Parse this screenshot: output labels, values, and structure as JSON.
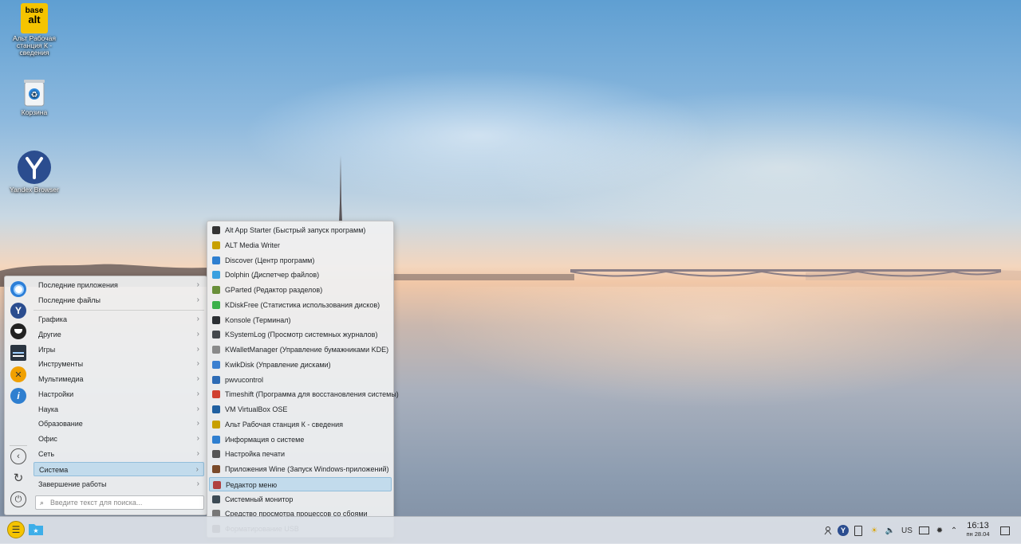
{
  "desktop": {
    "icons": [
      {
        "label": "Альт Рабочая станция К - сведения",
        "logo_text_top": "base",
        "logo_text_bottom": "alt"
      },
      {
        "label": "Корзина"
      },
      {
        "label": "Yandex Browser"
      }
    ]
  },
  "launcher": {
    "favorites": [
      "chromium-icon",
      "yandex-browser-icon",
      "app-icon",
      "system-monitor-icon",
      "tools-icon",
      "info-icon"
    ],
    "categories": [
      {
        "label": "Последние приложения"
      },
      {
        "label": "Последние файлы"
      },
      {
        "label": "Графика"
      },
      {
        "label": "Другие"
      },
      {
        "label": "Игры"
      },
      {
        "label": "Инструменты"
      },
      {
        "label": "Мультимедиа"
      },
      {
        "label": "Настройки"
      },
      {
        "label": "Наука"
      },
      {
        "label": "Образование"
      },
      {
        "label": "Офис"
      },
      {
        "label": "Сеть"
      },
      {
        "label": "Система"
      },
      {
        "label": "Завершение работы"
      }
    ],
    "selected_category": "Система",
    "search_placeholder": "Введите текст для поиска..."
  },
  "submenu": {
    "items": [
      {
        "label": "Alt App Starter (Быстрый запуск программ)",
        "color": "#333333"
      },
      {
        "label": "ALT Media Writer",
        "color": "#c8a000"
      },
      {
        "label": "Discover (Центр программ)",
        "color": "#2f7fd0"
      },
      {
        "label": "Dolphin (Диспетчер файлов)",
        "color": "#3aa0e0"
      },
      {
        "label": "GParted (Редактор разделов)",
        "color": "#6a8f3a"
      },
      {
        "label": "KDiskFree (Статистика использования дисков)",
        "color": "#3bb04a"
      },
      {
        "label": "Konsole (Терминал)",
        "color": "#2b2f33"
      },
      {
        "label": "KSystemLog (Просмотр системных журналов)",
        "color": "#44484c"
      },
      {
        "label": "KWalletManager (Управление бумажниками KDE)",
        "color": "#8a8a8a"
      },
      {
        "label": "KwikDisk (Управление дисками)",
        "color": "#3a7fd0"
      },
      {
        "label": "pwvucontrol",
        "color": "#2d6bb5"
      },
      {
        "label": "Timeshift (Программа для восстановления системы)",
        "color": "#d04030"
      },
      {
        "label": "VM VirtualBox OSE",
        "color": "#1f5fa0"
      },
      {
        "label": "Альт Рабочая станция К - сведения",
        "color": "#c8a000"
      },
      {
        "label": "Информация о системе",
        "color": "#2f7fd0"
      },
      {
        "label": "Настройка печати",
        "color": "#555555"
      },
      {
        "label": "Приложения Wine (Запуск Windows-приложений)",
        "color": "#7a4a2a"
      },
      {
        "label": "Редактор меню",
        "color": "#b04040"
      },
      {
        "label": "Системный монитор",
        "color": "#3c4a55"
      },
      {
        "label": "Средство просмотра процессов со сбоями",
        "color": "#777777"
      },
      {
        "label": "Форматирование USB",
        "color": "#444444"
      }
    ],
    "selected_item": "Редактор меню"
  },
  "taskbar": {
    "tray": [
      "network-icon",
      "yandex-browser-icon",
      "clipboard-icon",
      "weather-icon",
      "volume-icon"
    ],
    "keyboard_layout": "US",
    "tray_right": [
      "display-icon",
      "brightness-icon",
      "expand-tray-icon"
    ],
    "clock_time": "16:13",
    "clock_date": "пн 28.04"
  },
  "colors": {
    "accent": "#3daee9",
    "selection_bg": "#c2dbec",
    "menu_bg": "#eff0f1"
  }
}
